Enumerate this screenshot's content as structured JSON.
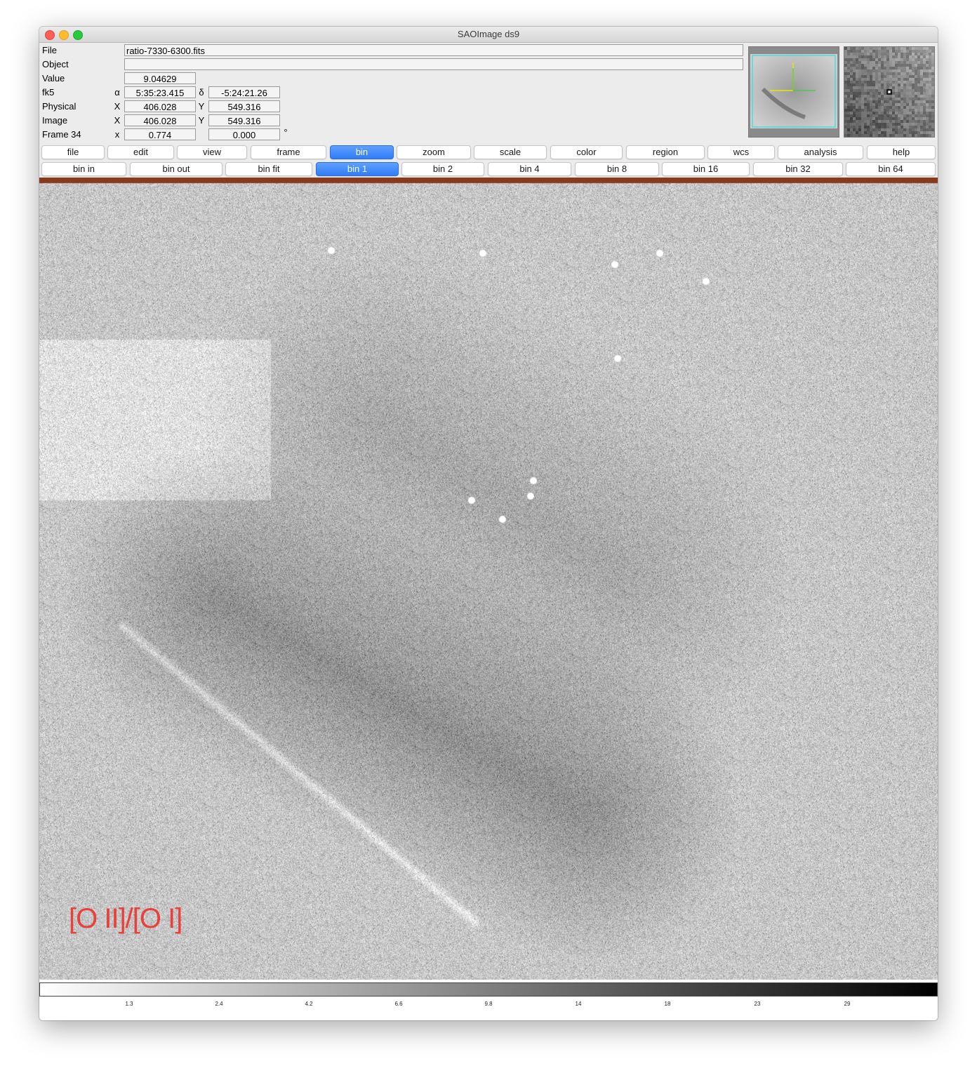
{
  "window": {
    "title": "SAOImage ds9"
  },
  "info": {
    "file_label": "File",
    "file_value": "ratio-7330-6300.fits",
    "object_label": "Object",
    "object_value": "",
    "value_label": "Value",
    "value_value": "9.04629",
    "fk5_label": "fk5",
    "fk5_alpha_symbol": "α",
    "fk5_alpha": "5:35:23.415",
    "fk5_delta_symbol": "δ",
    "fk5_delta": "-5:24:21.26",
    "physical_label": "Physical",
    "physical_x_label": "X",
    "physical_x": "406.028",
    "physical_y_label": "Y",
    "physical_y": "549.316",
    "image_label": "Image",
    "image_x_label": "X",
    "image_x": "406.028",
    "image_y_label": "Y",
    "image_y": "549.316",
    "frame_label": "Frame 34",
    "frame_zoom_label": "x",
    "frame_zoom": "0.774",
    "frame_angle": "0.000",
    "frame_angle_unit": "°"
  },
  "menu_buttons": [
    {
      "label": "file"
    },
    {
      "label": "edit"
    },
    {
      "label": "view"
    },
    {
      "label": "frame"
    },
    {
      "label": "bin",
      "active": true
    },
    {
      "label": "zoom"
    },
    {
      "label": "scale"
    },
    {
      "label": "color"
    },
    {
      "label": "region"
    },
    {
      "label": "wcs"
    },
    {
      "label": "analysis"
    },
    {
      "label": "help"
    }
  ],
  "bin_buttons": [
    {
      "label": "bin in"
    },
    {
      "label": "bin out"
    },
    {
      "label": "bin fit"
    },
    {
      "label": "bin 1",
      "active": true
    },
    {
      "label": "bin 2"
    },
    {
      "label": "bin 4"
    },
    {
      "label": "bin 8"
    },
    {
      "label": "bin 16"
    },
    {
      "label": "bin 32"
    },
    {
      "label": "bin 64"
    }
  ],
  "image": {
    "annotation": "[O II]/[O I]",
    "annotation_color": "#e8403a",
    "top_band_color": "#8a3a1c"
  },
  "colorbar": {
    "ticks": [
      "1.3",
      "2.4",
      "4.2",
      "6.6",
      "9.8",
      "14",
      "18",
      "23",
      "29"
    ],
    "gradient_from": "#ffffff",
    "gradient_to": "#000000"
  },
  "panner": {
    "frame_color": "#30e0e0",
    "compass_color": "#e8e800",
    "compass_alt_color": "#30d030"
  }
}
